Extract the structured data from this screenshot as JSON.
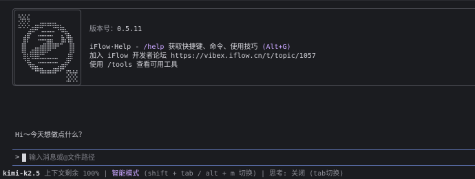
{
  "welcome": {
    "version_label": "版本号：",
    "version_value": "0.5.11",
    "help_prefix": "iFlow·Help - ",
    "help_command": "/help",
    "help_text": " 获取快捷键、命令、使用技巧 ",
    "help_shortcut": "(Alt+G)",
    "forum_line": "加入 iFlow 开发者论坛 https://vibex.iflow.cn/t/topic/1057",
    "tools_line": "使用 /tools 查看可用工具"
  },
  "greeting": "Hi～今天想做点什么？",
  "input": {
    "prompt": ">",
    "placeholder": "输入消息或@文件路径"
  },
  "status": {
    "model": "kimi-k2.5",
    "context": "上下文剩余 100%",
    "separator": "|",
    "mode": "智能模式",
    "mode_hint": "(shift + tab / alt + m 切换)",
    "thinking": "思考: 关闭 (tab切换)"
  },
  "colors": {
    "background": "#1b1c20",
    "accent": "#c9a6ff",
    "input_border": "#5a6ea8"
  },
  "icons": {
    "logo": "iflow-ascii-logo"
  }
}
